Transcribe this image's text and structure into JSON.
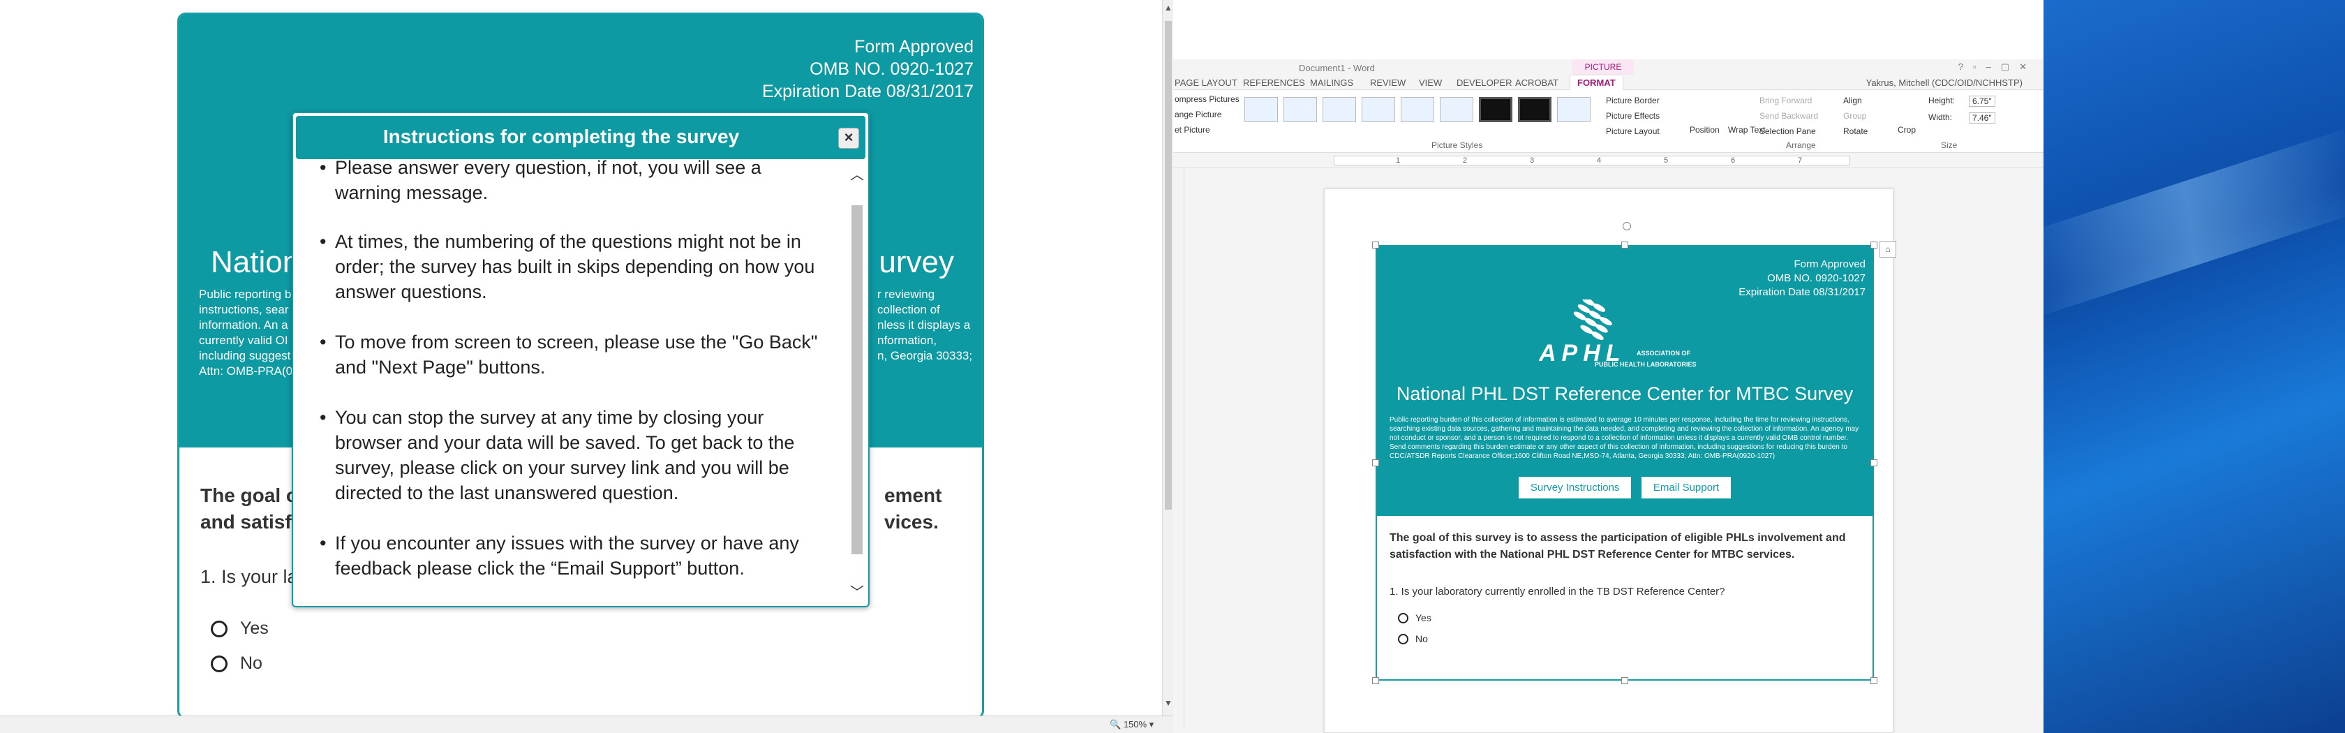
{
  "left": {
    "form_approved": "Form Approved",
    "omb": "OMB NO. 0920-1027",
    "expiration": "Expiration Date 08/31/2017",
    "title_left": "National",
    "title_right": "urvey",
    "para_lines": [
      "Public reporting b",
      "instructions, sear",
      "information. An a",
      "currently valid OI",
      "including suggest",
      "Attn: OMB-PRA(0"
    ],
    "para_lines_right": [
      "r reviewing",
      "collection of",
      "nless it displays a",
      "nformation,",
      "n, Georgia 30333;",
      ""
    ],
    "goal_left": [
      "The goal o",
      "and satisfa"
    ],
    "goal_right": [
      "ement",
      "vices."
    ],
    "question": "1. Is your la",
    "yes": "Yes",
    "no": "No",
    "zoom": "150%"
  },
  "modal": {
    "title": "Instructions for completing the survey",
    "close": "×",
    "items": [
      "Please answer every question, if not, you will see a warning message.",
      "At times, the numbering of the questions might not be in order; the survey has built in skips depending on how you answer questions.",
      "To move from screen to screen, please use the \"Go Back\" and \"Next Page\" buttons.",
      "You can stop the survey at any time by closing your browser and your data will be saved. To get back to the survey, please click on your survey link and you will be directed to the last unanswered question.",
      "If you encounter any issues with the survey or have any feedback please click the “Email Support” button."
    ]
  },
  "word": {
    "doc_title": "Document1 - Word",
    "picture_tools": "PICTURE TOOLS",
    "tabs": [
      "PAGE LAYOUT",
      "REFERENCES",
      "MAILINGS",
      "REVIEW",
      "VIEW",
      "DEVELOPER",
      "ACROBAT",
      "FORMAT"
    ],
    "user": "Yakrus, Mitchell (CDC/OID/NCHHSTP)",
    "adjust": [
      "ompress Pictures",
      "ange Picture",
      "et Picture"
    ],
    "picture_styles_label": "Picture Styles",
    "picture_border": "Picture Border",
    "picture_effects": "Picture Effects",
    "picture_layout": "Picture Layout",
    "position": "Position",
    "wrap_text": "Wrap Text",
    "bring_forward": "Bring Forward",
    "send_backward": "Send Backward",
    "selection_pane": "Selection Pane",
    "align": "Align",
    "group": "Group",
    "rotate": "Rotate",
    "arrange_label": "Arrange",
    "crop": "Crop",
    "height_label": "Height:",
    "height_value": "6.75\"",
    "width_label": "Width:",
    "width_value": "7.46\"",
    "size_label": "Size",
    "ruler_numbers": [
      "1",
      "2",
      "3",
      "4",
      "5",
      "6",
      "7"
    ]
  },
  "embedded": {
    "form_approved": "Form Approved",
    "omb": "OMB NO. 0920-1027",
    "expiration": "Expiration Date 08/31/2017",
    "logo_text": "APHL",
    "logo_sub1": "ASSOCIATION OF",
    "logo_sub2": "PUBLIC HEALTH LABORATORIES",
    "title": "National PHL DST Reference Center for MTBC Survey",
    "para": "Public reporting burden of this collection of information is estimated to average 10 minutes per response, including the time for reviewing instructions, searching existing data sources, gathering and maintaining the data needed, and completing and reviewing the collection of information. An agency may not conduct or sponsor, and a person is not required to respond to a collection of information unless it displays a currently valid OMB control number. Send comments regarding this burden estimate or any other aspect of this collection of information, including suggestions for reducing this burden to CDC/ATSDR Reports Clearance Officer;1600 Clifton Road NE,MSD-74, Atlanta, Georgia 30333; Attn: OMB-PRA(0920-1027)",
    "btn_instructions": "Survey Instructions",
    "btn_support": "Email Support",
    "goal": "The goal of this survey is to assess the participation of eligible PHLs involvement and satisfaction with the National PHL DST Reference Center for MTBC services.",
    "question": "1. Is your laboratory currently enrolled in the TB DST Reference Center?",
    "yes": "Yes",
    "no": "No"
  },
  "colors": {
    "teal": "#0d9aa3",
    "format_tab": "#a41c7a"
  }
}
